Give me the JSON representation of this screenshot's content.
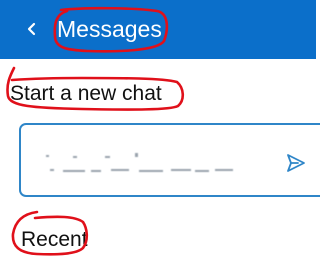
{
  "header": {
    "title": "Messages",
    "back_icon": "chevron-left-icon",
    "background": "#0b6fca"
  },
  "new_chat": {
    "label": "Start a new chat",
    "send_icon": "send-icon",
    "border_color": "#2f86c8"
  },
  "recent": {
    "label": "Recent"
  },
  "annotation_color": "#e0101a"
}
